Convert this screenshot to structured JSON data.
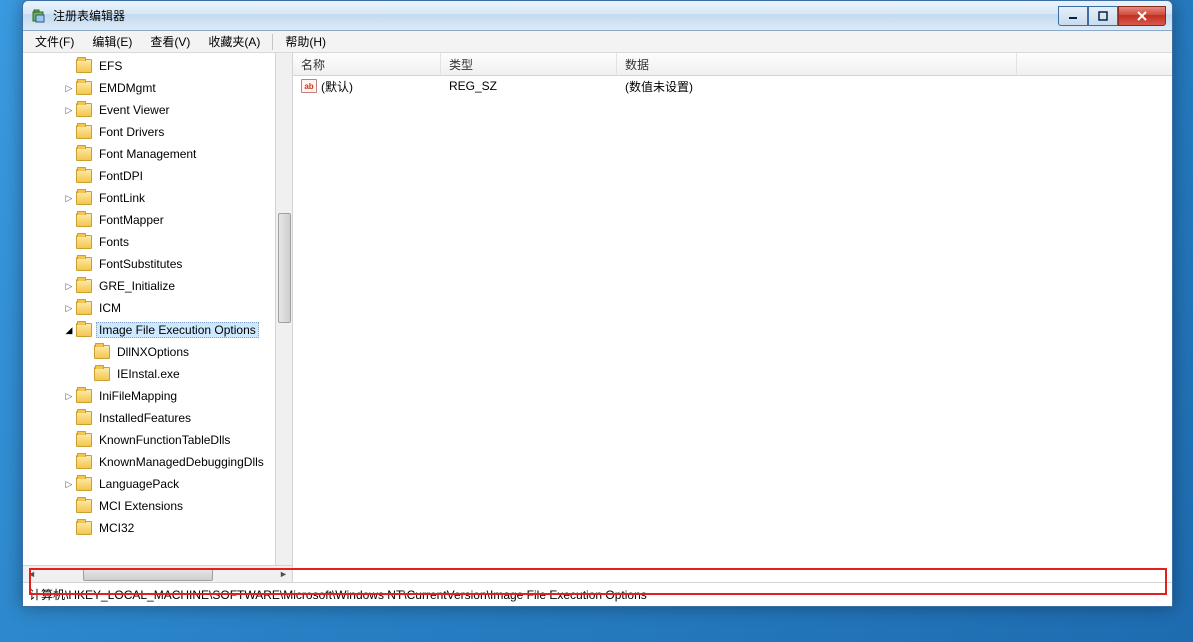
{
  "window": {
    "title": "注册表编辑器"
  },
  "menu": {
    "file": "文件(F)",
    "edit": "编辑(E)",
    "view": "查看(V)",
    "favorites": "收藏夹(A)",
    "help": "帮助(H)"
  },
  "tree": {
    "items": [
      {
        "label": "EFS",
        "indent": 1,
        "expander": ""
      },
      {
        "label": "EMDMgmt",
        "indent": 1,
        "expander": "▷"
      },
      {
        "label": "Event Viewer",
        "indent": 1,
        "expander": "▷"
      },
      {
        "label": "Font Drivers",
        "indent": 1,
        "expander": ""
      },
      {
        "label": "Font Management",
        "indent": 1,
        "expander": ""
      },
      {
        "label": "FontDPI",
        "indent": 1,
        "expander": ""
      },
      {
        "label": "FontLink",
        "indent": 1,
        "expander": "▷"
      },
      {
        "label": "FontMapper",
        "indent": 1,
        "expander": ""
      },
      {
        "label": "Fonts",
        "indent": 1,
        "expander": ""
      },
      {
        "label": "FontSubstitutes",
        "indent": 1,
        "expander": ""
      },
      {
        "label": "GRE_Initialize",
        "indent": 1,
        "expander": "▷"
      },
      {
        "label": "ICM",
        "indent": 1,
        "expander": "▷"
      },
      {
        "label": "Image File Execution Options",
        "indent": 1,
        "expander": "◢",
        "selected": true
      },
      {
        "label": "DllNXOptions",
        "indent": 2,
        "expander": ""
      },
      {
        "label": "IEInstal.exe",
        "indent": 2,
        "expander": ""
      },
      {
        "label": "IniFileMapping",
        "indent": 1,
        "expander": "▷"
      },
      {
        "label": "InstalledFeatures",
        "indent": 1,
        "expander": ""
      },
      {
        "label": "KnownFunctionTableDlls",
        "indent": 1,
        "expander": ""
      },
      {
        "label": "KnownManagedDebuggingDlls",
        "indent": 1,
        "expander": ""
      },
      {
        "label": "LanguagePack",
        "indent": 1,
        "expander": "▷"
      },
      {
        "label": "MCI Extensions",
        "indent": 1,
        "expander": ""
      },
      {
        "label": "MCI32",
        "indent": 1,
        "expander": ""
      }
    ]
  },
  "list": {
    "columns": {
      "name": "名称",
      "type": "类型",
      "data": "数据"
    },
    "rows": [
      {
        "name": "(默认)",
        "type": "REG_SZ",
        "data": "(数值未设置)"
      }
    ],
    "col_widths": {
      "name": 148,
      "type": 176,
      "data": 400
    }
  },
  "statusbar": {
    "path": "计算机\\HKEY_LOCAL_MACHINE\\SOFTWARE\\Microsoft\\Windows NT\\CurrentVersion\\Image File Execution Options"
  },
  "icons": {
    "value_badge": "ab"
  }
}
